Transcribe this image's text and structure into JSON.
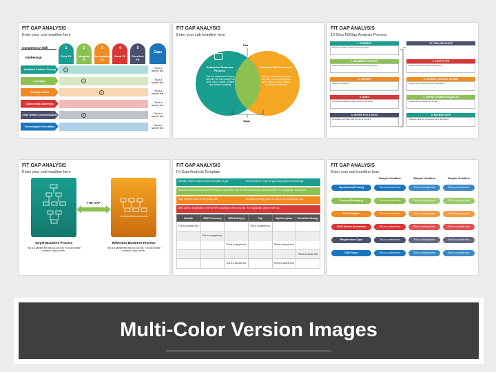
{
  "slide_title": "FIT GAP ANALYSIS",
  "subtitle": "Enter your sub headline here",
  "sample": "This is a sample text.",
  "sample_short": "This is a sample text.",
  "s1": {
    "competency": "Competency Skill",
    "intellectual": "Intellectual",
    "columns": [
      {
        "n": "1",
        "label": "Poor Fit",
        "color": "#1a9e8f"
      },
      {
        "n": "2",
        "label": "Marginal Fit",
        "color": "#8cc152"
      },
      {
        "n": "3",
        "label": "Acceptable Fit",
        "color": "#f08a24"
      },
      {
        "n": "4",
        "label": "Good Fit",
        "color": "#d93636"
      },
      {
        "n": "5",
        "label": "Excellent Fit",
        "color": "#4a4f6b"
      }
    ],
    "gaps": "Gaps",
    "gaps_color": "#1c75bc",
    "rows": [
      {
        "label": "Analytical Problem Solving",
        "color": "#1a9e8f",
        "check": 0
      },
      {
        "label": "Innovation",
        "color": "#8cc152",
        "check": 1
      },
      {
        "label": "Strategic Vision",
        "color": "#f08a24",
        "check": 2
      },
      {
        "label": "Commercial Awareness",
        "color": "#d93636",
        "check": -1
      },
      {
        "label": "Clear Written Communication",
        "color": "#4a4f6b",
        "check": 1
      },
      {
        "label": "Technological Orientation",
        "color": "#1c75bc",
        "check": -1
      }
    ]
  },
  "s2": {
    "fits": "Fits",
    "gaps": "Gaps",
    "left_title": "Enterprise Business Process",
    "right_title": "Standard ERP Processes",
    "icon_text": "ERP",
    "body": "This is a sample text that you can edit. You can change font (size, colour, name), or apply any desired formatting."
  },
  "s3": {
    "subtitle": "10 Step Fit/Gap Analysis Process",
    "left": [
      {
        "t": "1. SANDBOX",
        "c": "#1a9e8f",
        "b": "Prepare a sandbox environment for the project"
      },
      {
        "t": "2. BUSINESS PROCESS",
        "c": "#8cc152",
        "b": "Confirm business processes and functional requirements"
      },
      {
        "t": "3. TESTING",
        "c": "#f08a24",
        "b": "Define test scenarios"
      },
      {
        "t": "4. DEMO",
        "c": "#d93636",
        "b": "Functional consultants provide full demo of solution"
      },
      {
        "t": "5. DEFINE FITS & GAPS",
        "c": "#4a4f6b",
        "b": "Consultants and SMEs walk through all scenarios"
      }
    ],
    "right": [
      {
        "t": "10. FINALIZE SCOPE",
        "c": "#4a4f6b",
        "b": ""
      },
      {
        "t": "9. PROTOTYPE",
        "c": "#d93636",
        "b": "Develop prototypes for approved changes"
      },
      {
        "t": "8. CHANGE CONTROL REVIEW",
        "c": "#f08a24",
        "b": "All gap owners & assigned staff in attendance"
      },
      {
        "t": "7. DEFINE CHANGE REQUESTS",
        "c": "#8cc152",
        "b": "Prepare change requests for all gaps"
      },
      {
        "t": "6. REVIEW GAPS",
        "c": "#1a9e8f",
        "b": "Challenge gaps with all relevant staff in attendance"
      }
    ]
  },
  "s4": {
    "the_gap": "THE GAP",
    "left_title": "Target Business Process",
    "right_title": "Reference Business Process",
    "body": "This is a sample text that you can edit. You can change font(size, colour, name)"
  },
  "s5": {
    "subtitle": "Fit Gap Analysis Template",
    "bands": [
      {
        "c": "#1a9e8f",
        "l": "Identifier: Enter a unique number descriptive of gap.",
        "r": "Gap Description: Enter the gap & any system shortcomings."
      },
      {
        "c": "#8cc152",
        "l": "Business Reference Model (BRM) Process: If applicable, enter the BRM process(es) number and title. If not applicable, leave blank.",
        "r": ""
      },
      {
        "c": "#f08a24",
        "l": "Gap: Enter the name of the primary task.",
        "r": "Resolution Strategy: Enter the options for resolving the gap."
      },
      {
        "c": "#d93636",
        "l": "BRM Activity: If applicable, enter the BRM activity(s) number and title. If not applicable, please enter N/A.",
        "r": ""
      }
    ],
    "headers": [
      "Identifier",
      "BRM Process(es)",
      "BRM Activity(s)",
      "Gap",
      "Gap Description",
      "Resolution Strategy"
    ],
    "cells": [
      [
        0,
        3
      ],
      [
        1
      ],
      [
        2,
        4
      ],
      [
        5
      ],
      [
        2,
        4
      ]
    ]
  },
  "s6": {
    "headers": [
      "Sample Headline",
      "Sample Headline",
      "Sample Headline"
    ],
    "rows": [
      {
        "label": "Importance(Priority)",
        "c": "#1c75bc"
      },
      {
        "label": "Process(Category)",
        "c": "#8cc152"
      },
      {
        "label": "GAP Analysis",
        "c": "#f08a24"
      },
      {
        "label": "GAP Source (Location)",
        "c": "#d93636"
      },
      {
        "label": "Requirement Type",
        "c": "#4a4f6b"
      },
      {
        "label": "GAP Score",
        "c": "#1c75bc"
      }
    ]
  },
  "banner": "Multi-Color Version Images"
}
